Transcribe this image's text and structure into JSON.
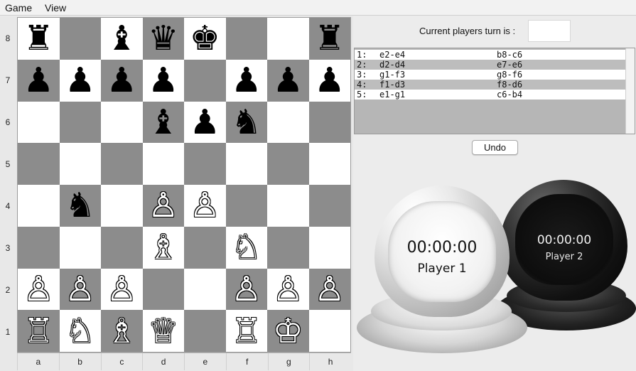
{
  "menubar": {
    "items": [
      "Game",
      "View"
    ]
  },
  "board": {
    "ranks": [
      "8",
      "7",
      "6",
      "5",
      "4",
      "3",
      "2",
      "1"
    ],
    "files": [
      "a",
      "b",
      "c",
      "d",
      "e",
      "f",
      "g",
      "h"
    ],
    "position": [
      [
        [
          "black",
          "rook"
        ],
        null,
        [
          "black",
          "bishop"
        ],
        [
          "black",
          "queen"
        ],
        [
          "black",
          "king"
        ],
        null,
        null,
        [
          "black",
          "rook"
        ]
      ],
      [
        [
          "black",
          "pawn"
        ],
        [
          "black",
          "pawn"
        ],
        [
          "black",
          "pawn"
        ],
        [
          "black",
          "pawn"
        ],
        null,
        [
          "black",
          "pawn"
        ],
        [
          "black",
          "pawn"
        ],
        [
          "black",
          "pawn"
        ]
      ],
      [
        null,
        null,
        null,
        [
          "black",
          "bishop"
        ],
        [
          "black",
          "pawn"
        ],
        [
          "black",
          "knight"
        ],
        null,
        null
      ],
      [
        null,
        null,
        null,
        null,
        null,
        null,
        null,
        null
      ],
      [
        null,
        [
          "black",
          "knight"
        ],
        null,
        [
          "white",
          "pawn"
        ],
        [
          "white",
          "pawn"
        ],
        null,
        null,
        null
      ],
      [
        null,
        null,
        null,
        [
          "white",
          "bishop"
        ],
        null,
        [
          "white",
          "knight"
        ],
        null,
        null
      ],
      [
        [
          "white",
          "pawn"
        ],
        [
          "white",
          "pawn"
        ],
        [
          "white",
          "pawn"
        ],
        null,
        null,
        [
          "white",
          "pawn"
        ],
        [
          "white",
          "pawn"
        ],
        [
          "white",
          "pawn"
        ]
      ],
      [
        [
          "white",
          "rook"
        ],
        [
          "white",
          "knight"
        ],
        [
          "white",
          "bishop"
        ],
        [
          "white",
          "queen"
        ],
        null,
        [
          "white",
          "rook"
        ],
        [
          "white",
          "king"
        ],
        null
      ]
    ]
  },
  "turn": {
    "label": "Current players turn is :",
    "value": ""
  },
  "moves": [
    {
      "num": "1:",
      "white": "e2-e4",
      "black": "b8-c6"
    },
    {
      "num": "2:",
      "white": "d2-d4",
      "black": "e7-e6"
    },
    {
      "num": "3:",
      "white": "g1-f3",
      "black": "g8-f6"
    },
    {
      "num": "4:",
      "white": "f1-d3",
      "black": "f8-d6"
    },
    {
      "num": "5:",
      "white": "e1-g1",
      "black": "c6-b4"
    }
  ],
  "undo_label": "Undo",
  "clocks": {
    "player1": {
      "time": "00:00:00",
      "name": "Player 1"
    },
    "player2": {
      "time": "00:00:00",
      "name": "Player 2"
    }
  }
}
